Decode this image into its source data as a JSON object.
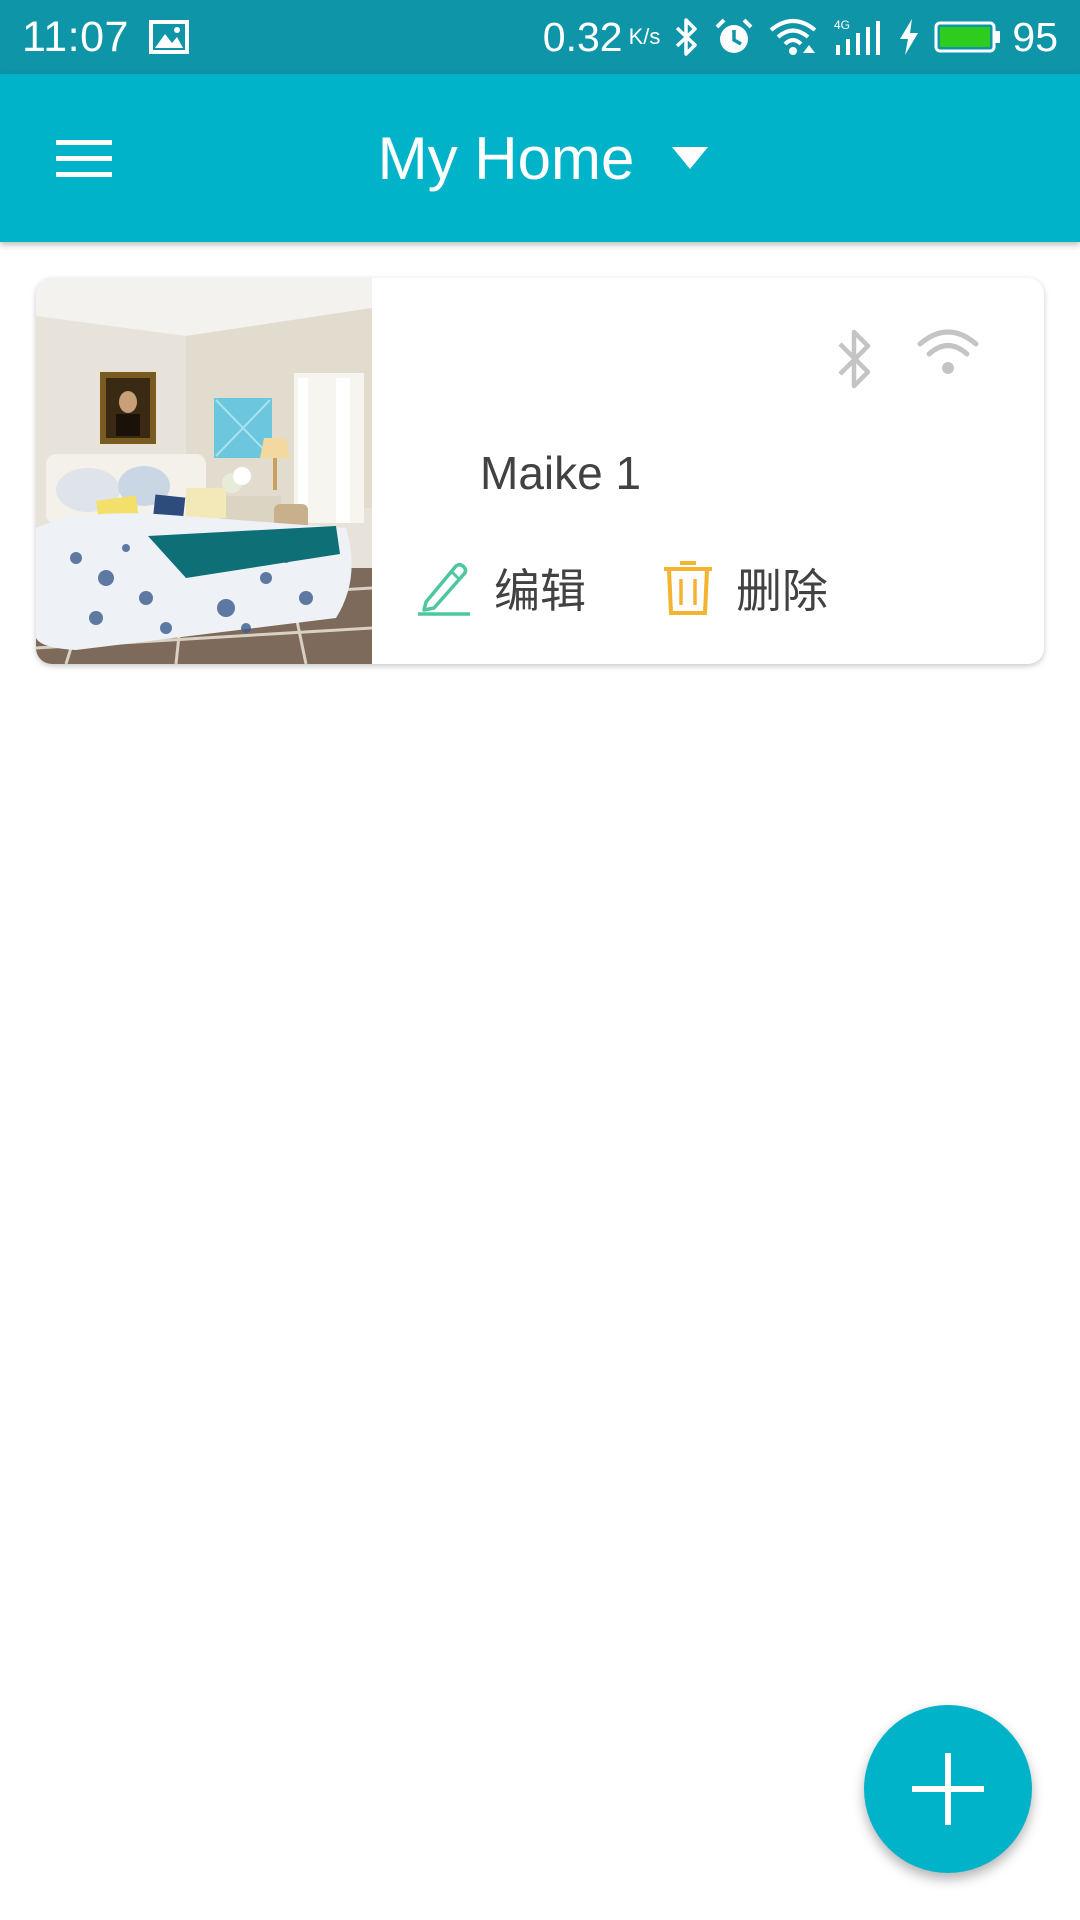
{
  "status_bar": {
    "time": "11:07",
    "net_speed": "0.32",
    "net_speed_unit": "K/s",
    "battery_level": "95",
    "icons": [
      "image-icon",
      "bluetooth-icon",
      "alarm-icon",
      "wifi-icon",
      "signal-4g-icon",
      "charging-icon",
      "battery-icon"
    ]
  },
  "app_bar": {
    "title": "My Home",
    "menu_icon": "hamburger-menu-icon",
    "dropdown_icon": "dropdown-arrow-icon"
  },
  "rooms": [
    {
      "name": "Maike 1",
      "photo": "bedroom-photo",
      "status_icons": [
        "bluetooth-icon",
        "wifi-icon"
      ],
      "actions": {
        "edit_label": "编辑",
        "delete_label": "删除"
      }
    }
  ],
  "fab": {
    "icon": "plus-icon"
  },
  "colors": {
    "status_bar": "#0e95a8",
    "app_bar": "#00b3c9",
    "fab": "#00b3c9",
    "edit_icon": "#4cc7a0",
    "delete_icon": "#f2b431",
    "inactive_icon": "#c4c4c4",
    "battery_fill": "#2ecc1e"
  }
}
